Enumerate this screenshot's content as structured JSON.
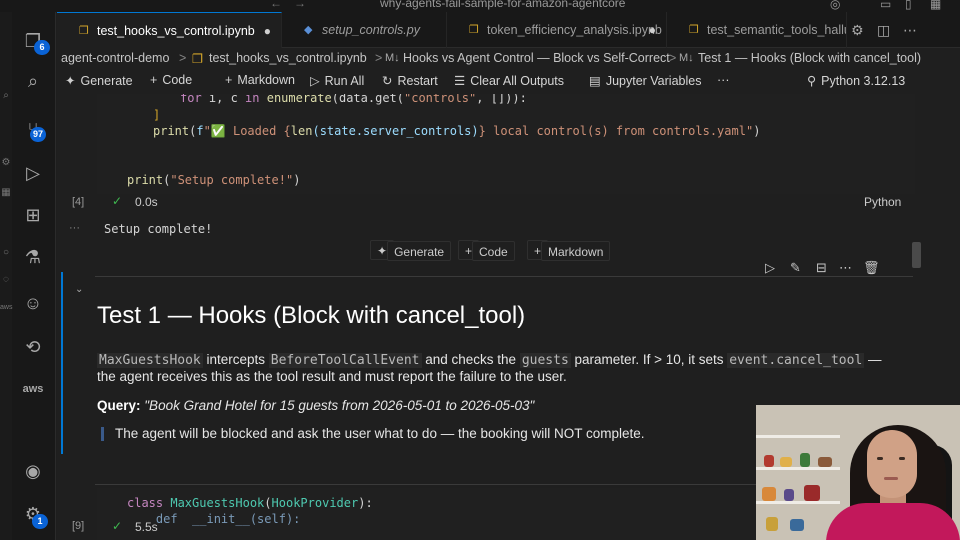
{
  "window": {
    "title": "why-agents-fail-sample-for-amazon-agentcore"
  },
  "activity": {
    "explorer_badge": "6",
    "scm_badge": "97",
    "accounts_badge": "1"
  },
  "tabs": [
    {
      "label": "test_hooks_vs_control.ipynb",
      "modified": true,
      "active": true
    },
    {
      "label": "setup_controls.py",
      "modified": false,
      "active": false
    },
    {
      "label": "token_efficiency_analysis.ipynb",
      "modified": true,
      "active": false
    },
    {
      "label": "test_semantic_tools_hallu",
      "modified": false,
      "active": false
    }
  ],
  "breadcrumb": {
    "folder": "agent-control-demo",
    "file": "test_hooks_vs_control.ipynb",
    "section": "Hooks vs Agent Control — Block vs Self-Correct",
    "subsection": "Test 1 — Hooks (Block with cancel_tool)",
    "md_prefix": "M↓",
    "sep": ">"
  },
  "toolbar": {
    "generate": "Generate",
    "code": "Code",
    "markdown": "Markdown",
    "run_all": "Run All",
    "restart": "Restart",
    "clear_outputs": "Clear All Outputs",
    "variables": "Jupyter Variables",
    "more": "···",
    "kernel": "Python 3.12.13"
  },
  "cell4": {
    "line1_for": "for",
    "line1_rest": " i, c ",
    "line1_in": "in",
    "line1_fn": " enumerate",
    "line1_args": "(data.get(",
    "line1_str": "\"controls\"",
    "line1_tail": ", [])):",
    "line2": "]",
    "line3_fn": "print",
    "line3_open": "(",
    "line3_f": "f",
    "line3_str1": "\"✅ Loaded {",
    "line3_len": "len",
    "line3_mid": "(state.server_controls)",
    "line3_str2": "} local control(s) from controls.yaml\"",
    "line3_close": ")",
    "line4_fn": "print",
    "line4_open": "(",
    "line4_str": "\"Setup complete!\"",
    "line4_close": ")",
    "exec_num": "[4]",
    "duration": "0.0s",
    "language": "Python",
    "output": "Setup complete!",
    "output_more": "···"
  },
  "insert": {
    "generate": "Generate",
    "code": "Code",
    "markdown": "Markdown"
  },
  "markdown": {
    "heading": "Test 1 — Hooks (Block with cancel_tool)",
    "p1_code1": "MaxGuestsHook",
    "p1_t1": " intercepts ",
    "p1_code2": "BeforeToolCallEvent",
    "p1_t2": " and checks the ",
    "p1_code3": "guests",
    "p1_t3": " parameter. If > 10, it sets ",
    "p1_code4": "event.cancel_tool",
    "p1_t4": " —",
    "p1_line2": "the agent receives this as the tool result and must report the failure to the user.",
    "query_label": "Query:",
    "query_text": " \"Book Grand Hotel for 15 guests from 2026-05-01 to 2026-05-03\"",
    "quote": "The agent will be blocked and ask the user what to do — the booking will NOT complete."
  },
  "cell9": {
    "kw_class": "class",
    "cls_name": " MaxGuestsHook",
    "paren": "(",
    "base": "HookProvider",
    "tail": "):",
    "line2": "    def  __init__(self):",
    "exec_num": "[9]",
    "duration": "5.5s"
  }
}
